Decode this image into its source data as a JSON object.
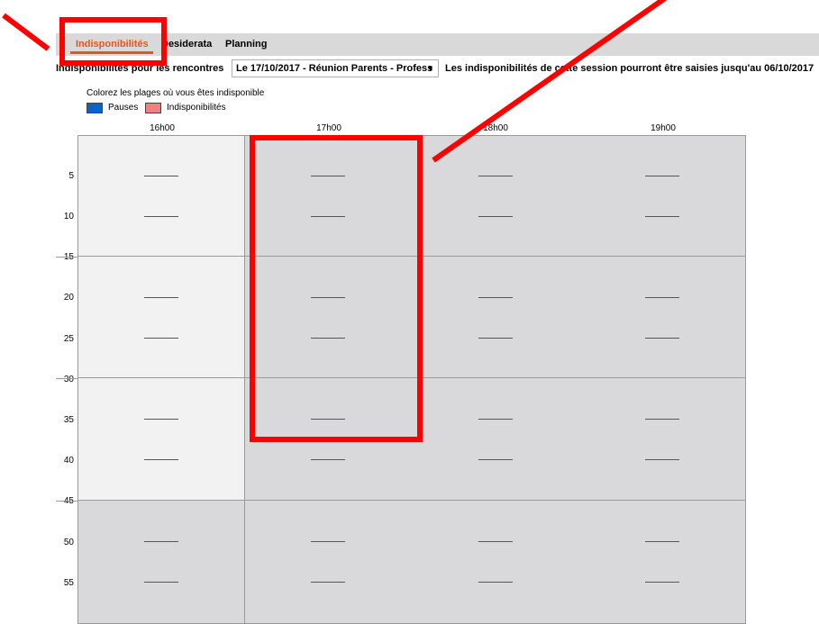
{
  "tabs": [
    {
      "label": "Indisponibilités",
      "active": true
    },
    {
      "label": "Desiderata",
      "active": false
    },
    {
      "label": "Planning",
      "active": false
    }
  ],
  "session": {
    "label": "Indisponibilités pour les rencontres",
    "selected": "Le 17/10/2017 - Réunion Parents - Profess",
    "note": "Les indisponibilités de cette session pourront être saisies jusqu'au 06/10/2017"
  },
  "instructions": "Colorez les plages où vous êtes indisponible",
  "legend": [
    {
      "label": "Pauses",
      "color": "#0a63c8"
    },
    {
      "label": "Indisponibilités",
      "color": "#f08080"
    }
  ],
  "hours": [
    "16h00",
    "17h00",
    "18h00",
    "19h00"
  ],
  "minutes": [
    "5",
    "10",
    "15",
    "20",
    "25",
    "30",
    "35",
    "40",
    "45",
    "50",
    "55"
  ],
  "colors": {
    "accent": "#e0581e",
    "available": "#f2f2f2",
    "unavailable": "#d9d9db",
    "annotation": "#ff0000"
  }
}
